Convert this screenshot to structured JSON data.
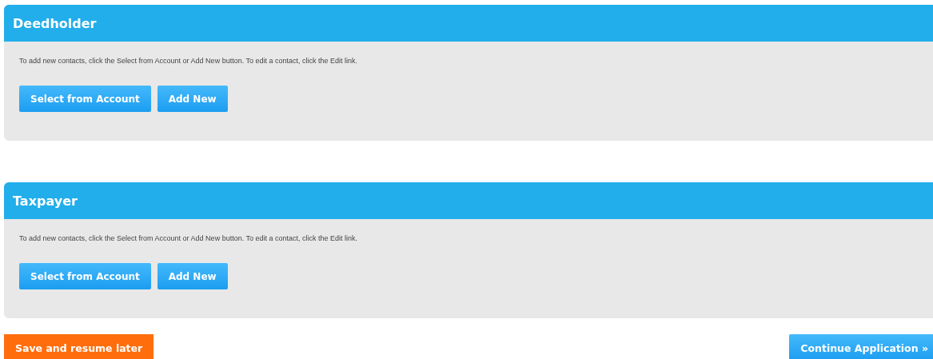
{
  "sections": [
    {
      "title": "Deedholder",
      "instructions": "To add new contacts, click the Select from Account or Add New button. To edit a contact, click the Edit link.",
      "buttons": [
        "Select from Account",
        "Add New"
      ]
    },
    {
      "title": "Taxpayer",
      "instructions": "To add new contacts, click the Select from Account or Add New button. To edit a contact, click the Edit link.",
      "buttons": [
        "Select from Account",
        "Add New"
      ]
    }
  ],
  "footer": {
    "save_button": "Save and resume later",
    "continue_button": "Continue Application »"
  }
}
